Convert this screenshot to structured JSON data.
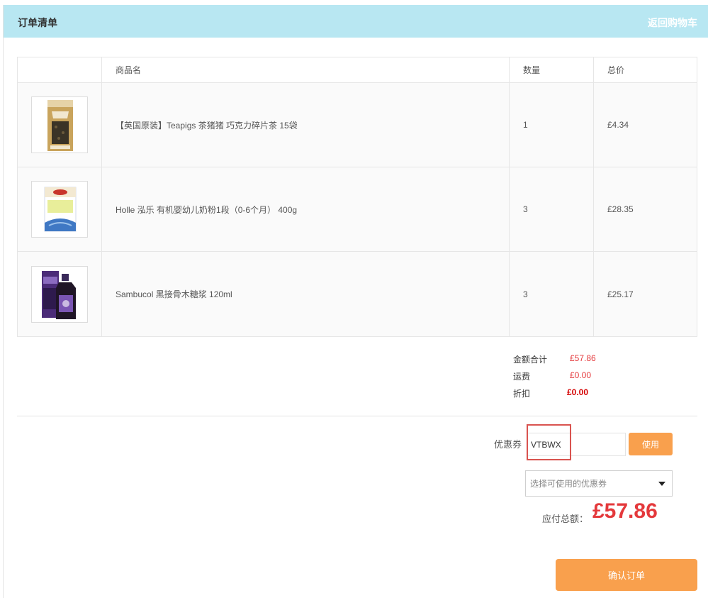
{
  "header": {
    "title": "订单清单",
    "back_link": "返回购物车"
  },
  "table": {
    "columns": [
      "",
      "商品名",
      "数量",
      "总价"
    ],
    "rows": [
      {
        "name": "【英国原装】Teapigs 茶猪猪 巧克力碎片茶 15袋",
        "qty": "1",
        "total": "£4.34",
        "thumb": "tea-box-image"
      },
      {
        "name": "Holle 泓乐 有机婴幼儿奶粉1段（0-6个月） 400g",
        "qty": "3",
        "total": "£28.35",
        "thumb": "formula-box-image"
      },
      {
        "name": "Sambucol 黑接骨木糖浆 120ml",
        "qty": "3",
        "total": "£25.17",
        "thumb": "syrup-bottle-image"
      }
    ]
  },
  "summary": {
    "subtotal_label": "金额合计",
    "subtotal": "£57.86",
    "shipping_label": "运费",
    "shipping": "£0.00",
    "discount_label": "折扣",
    "discount": "£0.00"
  },
  "coupon": {
    "label": "优惠券",
    "value": "VTBWX",
    "use_button": "使用",
    "select_placeholder": "选择可使用的优惠券"
  },
  "due": {
    "label": "应付总额：",
    "amount": "£57.86"
  },
  "confirm_button": "确认订单",
  "colors": {
    "header_bg": "#b8e7f2",
    "accent": "#f9a04d",
    "price_red": "#e4393c"
  }
}
